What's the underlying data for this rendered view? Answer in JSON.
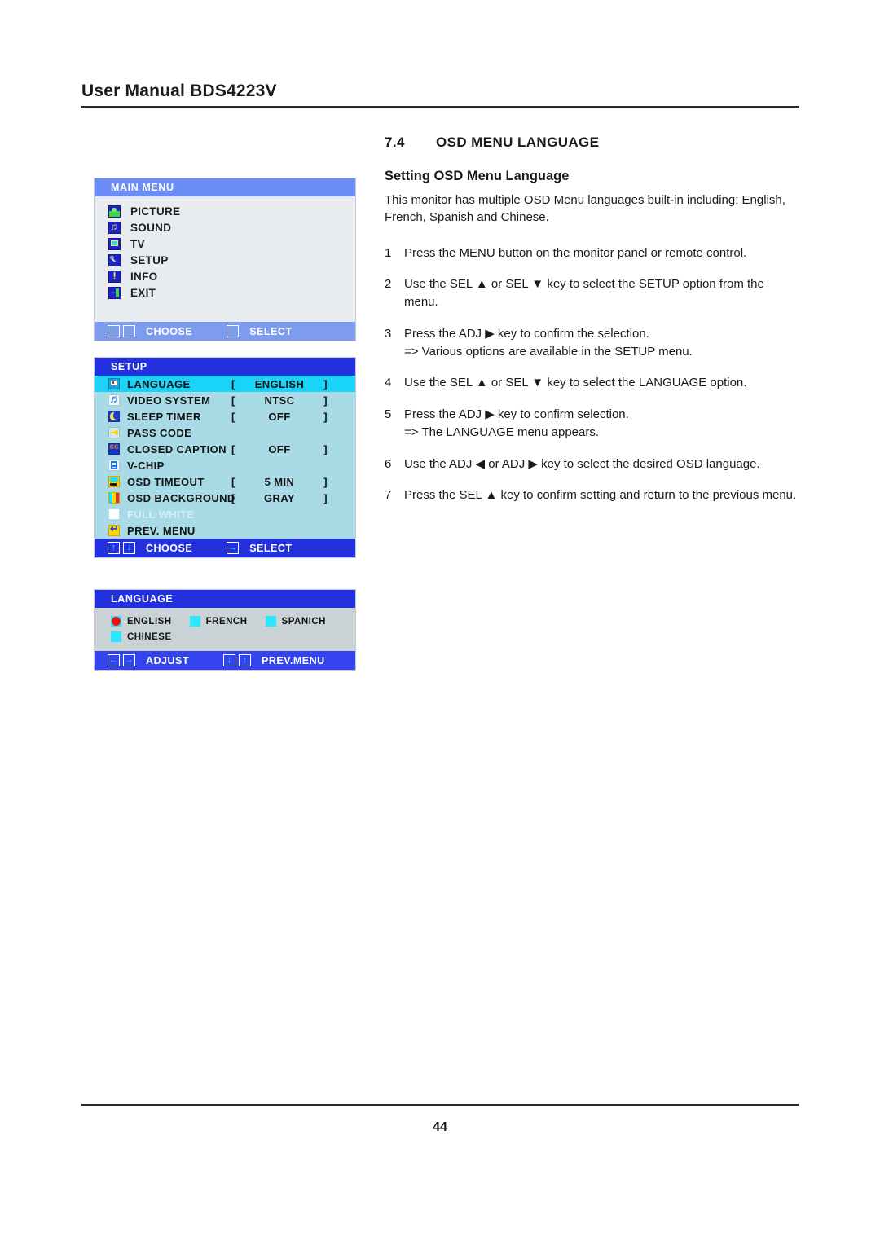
{
  "header": {
    "title": "User Manual BDS4223V"
  },
  "footer": {
    "page_number": "44"
  },
  "section": {
    "number": "7.4",
    "title": "OSD MENU LANGUAGE",
    "subtitle": "Setting OSD Menu Language",
    "intro": "This monitor has multiple OSD Menu languages built-in including: English, French, Spanish and Chinese.",
    "steps": [
      {
        "num": "1",
        "text": "Press the MENU button on the monitor panel or remote control.",
        "note": ""
      },
      {
        "num": "2",
        "text": "Use the SEL ▲ or SEL ▼ key to select the SETUP option from the menu.",
        "note": ""
      },
      {
        "num": "3",
        "text": "Press the ADJ ▶ key to confirm the selection.",
        "note": "=> Various options are available in the SETUP menu."
      },
      {
        "num": "4",
        "text": "Use  the SEL ▲ or SEL ▼ key to select the LANGUAGE option.",
        "note": ""
      },
      {
        "num": "5",
        "text": "Press the ADJ ▶  key to confirm selection.",
        "note": "=> The LANGUAGE menu appears."
      },
      {
        "num": "6",
        "text": "Use the ADJ ◀ or ADJ ▶  key to select the desired OSD language.",
        "note": ""
      },
      {
        "num": "7",
        "text": " Press the SEL ▲ key to confirm setting and return to the previous menu.",
        "note": ""
      }
    ]
  },
  "main_menu": {
    "title": "MAIN  MENU",
    "items": [
      {
        "label": "PICTURE",
        "icon": "picture-icon"
      },
      {
        "label": "SOUND",
        "icon": "sound-icon"
      },
      {
        "label": "TV",
        "icon": "tv-icon"
      },
      {
        "label": "SETUP",
        "icon": "setup-wrench-icon"
      },
      {
        "label": "INFO",
        "icon": "info-icon"
      },
      {
        "label": "EXIT",
        "icon": "exit-icon"
      }
    ],
    "footer": {
      "up_glyph": "↑",
      "down_glyph": "↓",
      "choose_label": "CHOOSE",
      "right_glyph": "→",
      "select_label": "SELECT"
    }
  },
  "setup_menu": {
    "title": "SETUP",
    "rows": [
      {
        "name": "LANGUAGE",
        "open": "[",
        "value": "ENGLISH",
        "close": "]",
        "icon": "language-icon",
        "selected": true,
        "dim": false
      },
      {
        "name": "VIDEO SYSTEM",
        "open": "[",
        "value": "NTSC",
        "close": "]",
        "icon": "video-system-icon",
        "selected": false,
        "dim": false
      },
      {
        "name": "SLEEP TIMER",
        "open": "[",
        "value": "OFF",
        "close": "]",
        "icon": "sleep-timer-icon",
        "selected": false,
        "dim": false
      },
      {
        "name": "PASS CODE",
        "open": "",
        "value": "",
        "close": "",
        "icon": "pass-code-icon",
        "selected": false,
        "dim": false
      },
      {
        "name": "CLOSED CAPTION",
        "open": "[",
        "value": "OFF",
        "close": "]",
        "icon": "closed-caption-icon",
        "selected": false,
        "dim": false
      },
      {
        "name": "V-CHIP",
        "open": "",
        "value": "",
        "close": "",
        "icon": "v-chip-icon",
        "selected": false,
        "dim": false
      },
      {
        "name": "OSD TIMEOUT",
        "open": "[",
        "value": "5 MIN",
        "close": "]",
        "icon": "osd-timeout-icon",
        "selected": false,
        "dim": false
      },
      {
        "name": "OSD BACKGROUND",
        "open": "[",
        "value": "GRAY",
        "close": "]",
        "icon": "osd-background-icon",
        "selected": false,
        "dim": false
      },
      {
        "name": "FULL WHITE",
        "open": "",
        "value": "",
        "close": "",
        "icon": "full-white-icon",
        "selected": false,
        "dim": true
      },
      {
        "name": "PREV. MENU",
        "open": "",
        "value": "",
        "close": "",
        "icon": "prev-menu-icon",
        "selected": false,
        "dim": false
      }
    ],
    "footer": {
      "up_glyph": "↑",
      "down_glyph": "↓",
      "choose_label": "CHOOSE",
      "right_glyph": "→",
      "select_label": "SELECT"
    }
  },
  "language_menu": {
    "title": "LANGUAGE",
    "options": [
      {
        "label": "ENGLISH",
        "selected": true
      },
      {
        "label": "FRENCH",
        "selected": false
      },
      {
        "label": "SPANICH",
        "selected": false
      },
      {
        "label": "CHINESE",
        "selected": false
      }
    ],
    "footer": {
      "left_glyph": "←",
      "right_glyph": "→",
      "adjust_label": "ADJUST",
      "down_glyph": "↓",
      "up_glyph": "↑",
      "prev_label": "PREV.MENU"
    }
  },
  "colors": {
    "main_title_bar": "#6b8df5",
    "main_body": "#e9ecee",
    "main_footer_bar": "#7d9cf0",
    "setup_title_bar": "#2330e0",
    "setup_body": "#a8dbe6",
    "setup_selected_row": "#1ad4f8",
    "lang_body": "#c9d3d6",
    "lang_footer_bar": "#3344ee",
    "swatch": "#2fe6ff",
    "radio_selected": "#ee1111"
  }
}
